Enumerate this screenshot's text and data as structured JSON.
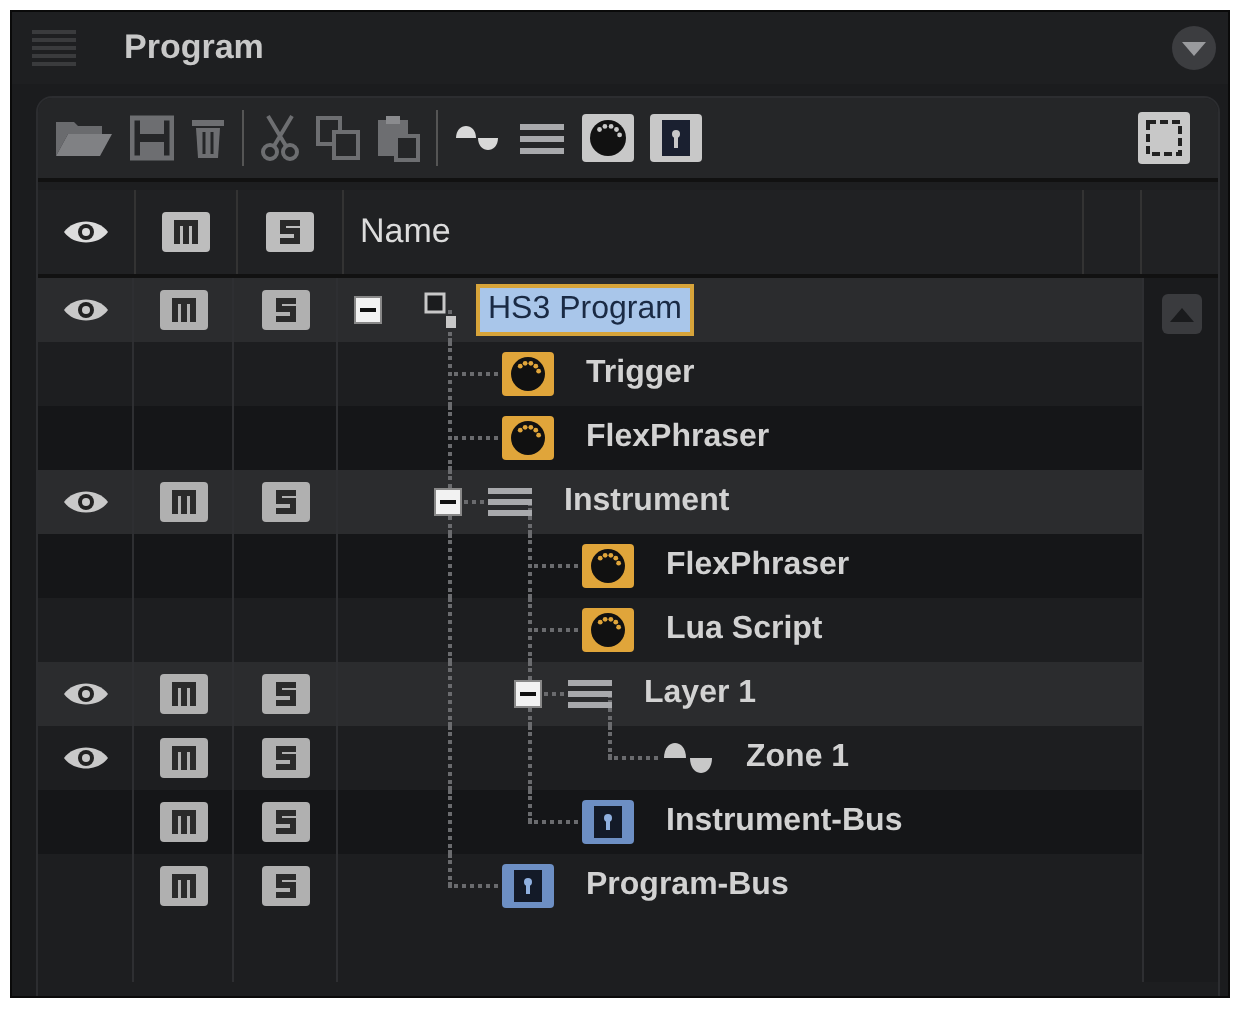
{
  "panel": {
    "title": "Program"
  },
  "header": {
    "name": "Name"
  },
  "tree": [
    {
      "name": "HS3 Program",
      "kind": "program",
      "selected": true,
      "expanded": true,
      "eye": true,
      "mute_solo": true,
      "children": [
        {
          "name": "Trigger",
          "kind": "midi",
          "selected": false,
          "eye": false,
          "mute_solo": false
        },
        {
          "name": "FlexPhraser",
          "kind": "midi",
          "selected": false,
          "eye": false,
          "mute_solo": false
        },
        {
          "name": "Instrument",
          "kind": "layer",
          "selected": false,
          "expanded": true,
          "eye": true,
          "mute_solo": true,
          "children": [
            {
              "name": "FlexPhraser",
              "kind": "midi",
              "selected": false,
              "eye": false,
              "mute_solo": false
            },
            {
              "name": "Lua Script",
              "kind": "midi",
              "selected": false,
              "eye": false,
              "mute_solo": false
            },
            {
              "name": "Layer 1",
              "kind": "layer",
              "selected": false,
              "expanded": true,
              "eye": true,
              "mute_solo": true,
              "children": [
                {
                  "name": "Zone 1",
                  "kind": "zone",
                  "selected": false,
                  "eye": true,
                  "mute_solo": true
                }
              ]
            },
            {
              "name": "Instrument-Bus",
              "kind": "bus",
              "selected": false,
              "eye": false,
              "mute_solo": true
            }
          ]
        },
        {
          "name": "Program-Bus",
          "kind": "bus",
          "selected": false,
          "eye": false,
          "mute_solo": true
        }
      ]
    }
  ]
}
